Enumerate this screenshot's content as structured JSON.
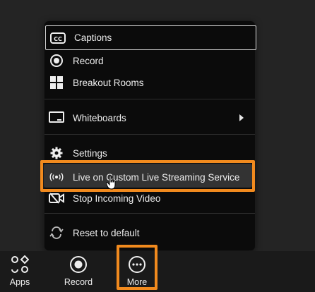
{
  "menu": {
    "items": [
      {
        "label": "Captions",
        "icon": "cc-icon"
      },
      {
        "label": "Record",
        "icon": "record-icon"
      },
      {
        "label": "Breakout Rooms",
        "icon": "grid-icon"
      },
      {
        "label": "Whiteboards",
        "icon": "whiteboard-icon"
      },
      {
        "label": "Settings",
        "icon": "gear-icon"
      },
      {
        "label": "Live on Custom Live Streaming Service",
        "icon": "broadcast-icon"
      },
      {
        "label": "Stop Incoming Video",
        "icon": "video-off-icon"
      },
      {
        "label": "Reset to default",
        "icon": "reset-icon"
      }
    ]
  },
  "toolbar": {
    "apps_label": "Apps",
    "record_label": "Record",
    "more_label": "More"
  },
  "colors": {
    "highlight": "#f18a1e",
    "menu_bg": "#0b0b0b",
    "toolbar_bg": "#1a1a1a"
  }
}
